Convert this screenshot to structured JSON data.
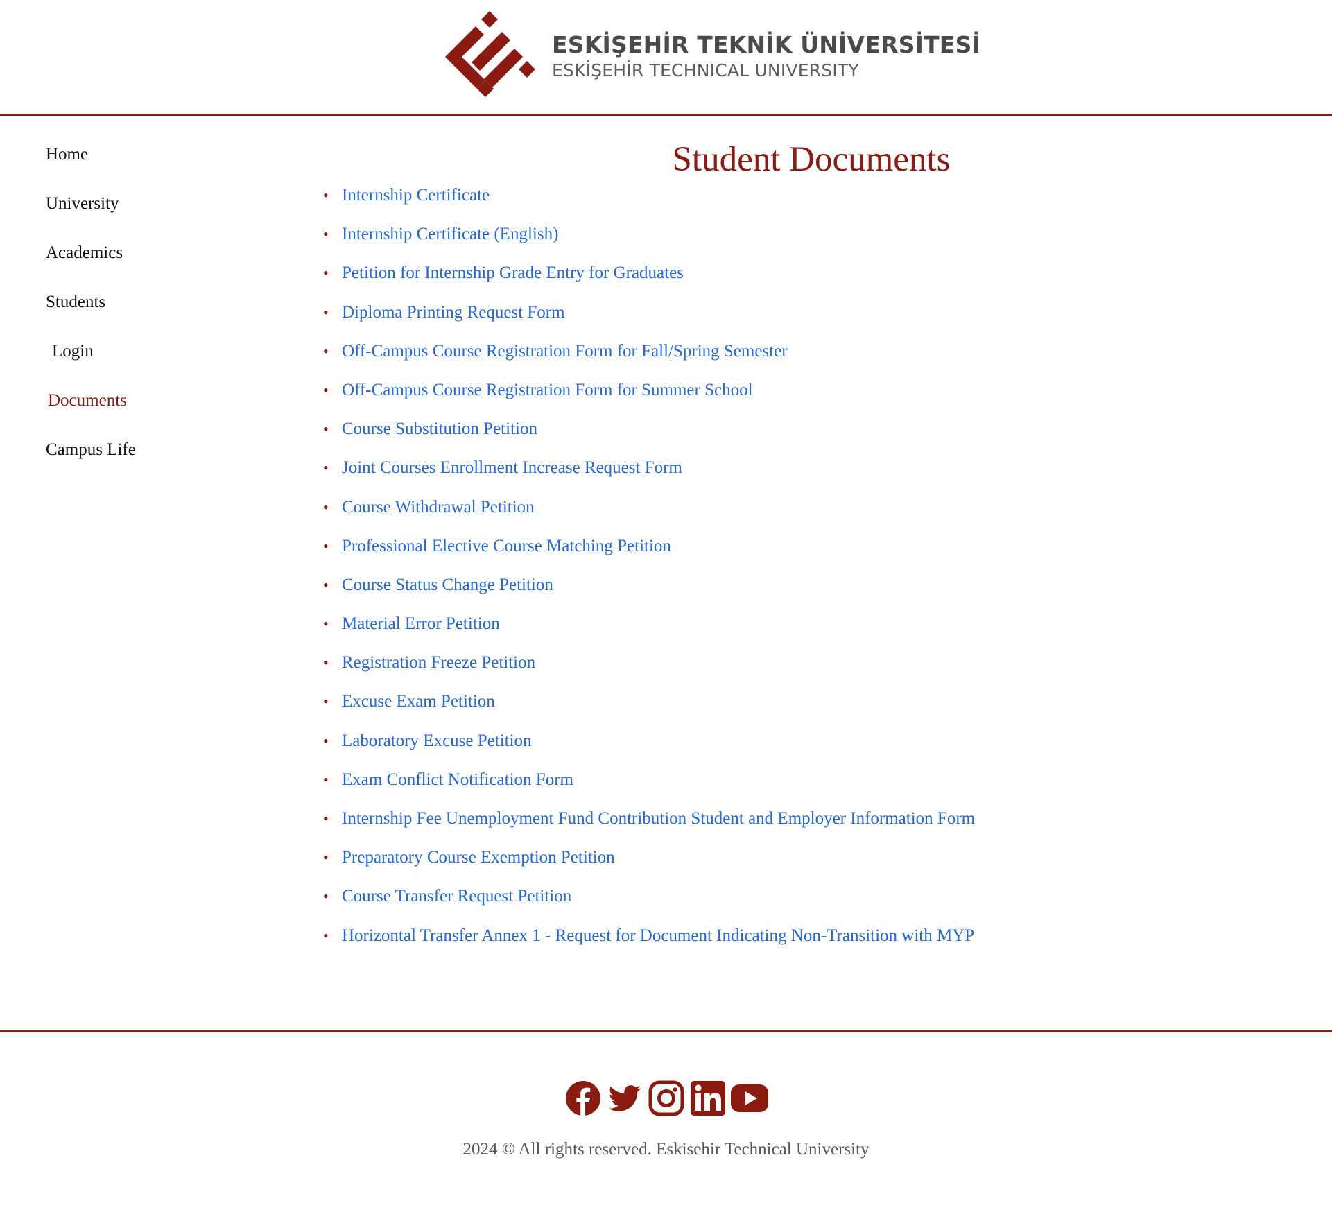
{
  "header": {
    "logo_title": "ESKİŞEHİR TEKNİK ÜNİVERSİTESİ",
    "logo_subtitle": "ESKİŞEHİR TECHNICAL UNIVERSITY"
  },
  "sidebar": {
    "items": [
      {
        "label": "Home"
      },
      {
        "label": "University"
      },
      {
        "label": "Academics"
      },
      {
        "label": "Students"
      },
      {
        "label": "Login"
      },
      {
        "label": "Documents",
        "active": true
      },
      {
        "label": "Campus Life"
      }
    ]
  },
  "main": {
    "title": "Student Documents",
    "documents": [
      "Internship Certificate",
      "Internship Certificate (English)",
      "Petition for Internship Grade Entry for Graduates",
      "Diploma Printing Request Form",
      "Off-Campus Course Registration Form for Fall/Spring Semester",
      "Off-Campus Course Registration Form for Summer School",
      "Course Substitution Petition",
      "Joint Courses Enrollment Increase Request Form",
      "Course Withdrawal Petition",
      "Professional Elective Course Matching Petition",
      "Course Status Change Petition",
      "Material Error Petition",
      "Registration Freeze Petition",
      "Excuse Exam Petition",
      "Laboratory Excuse Petition",
      "Exam Conflict Notification Form",
      "Internship Fee Unemployment Fund Contribution Student and Employer Information Form",
      "Preparatory Course Exemption Petition",
      "Course Transfer Request Petition",
      "Horizontal Transfer Annex 1 - Request for Document Indicating Non-Transition with MYP"
    ]
  },
  "footer": {
    "social_icons": [
      "facebook-icon",
      "twitter-icon",
      "instagram-icon",
      "linkedin-icon",
      "youtube-icon"
    ],
    "copyright": "2024 © All rights reserved. Eskisehir Technical University"
  },
  "colors": {
    "brand": "#8b1a10",
    "link": "#2368e0",
    "text": "#111111",
    "muted": "#555555"
  }
}
